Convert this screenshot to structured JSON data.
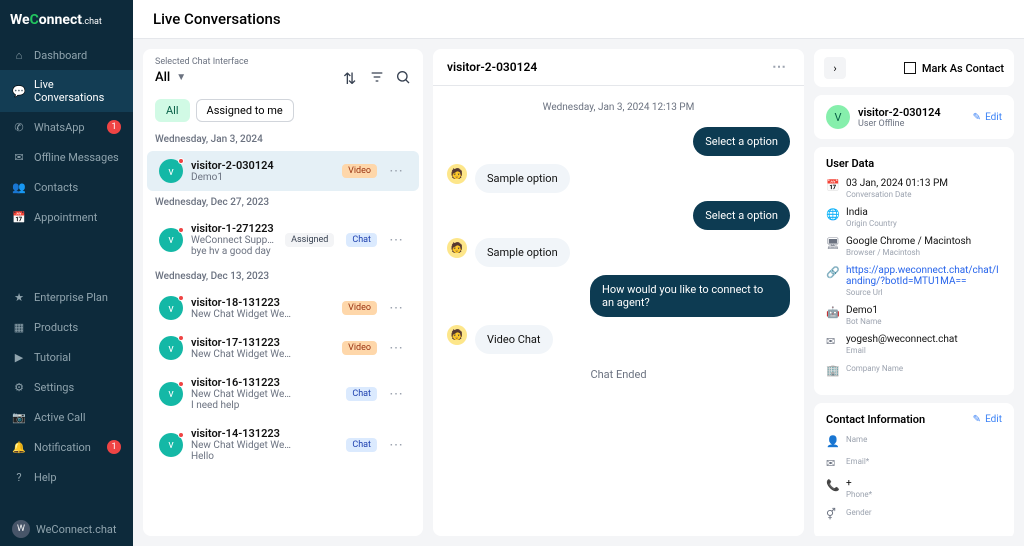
{
  "brand": {
    "pre": "We",
    "c": "C",
    "post": "onnect",
    "suffix": ".chat"
  },
  "page_title": "Live Conversations",
  "nav": [
    {
      "label": "Dashboard",
      "icon": "home"
    },
    {
      "label": "Live Conversations",
      "icon": "chat",
      "active": true
    },
    {
      "label": "WhatsApp",
      "icon": "whatsapp",
      "badge": "1"
    },
    {
      "label": "Offline Messages",
      "icon": "inbox"
    },
    {
      "label": "Contacts",
      "icon": "contacts"
    },
    {
      "label": "Appointment",
      "icon": "calendar"
    }
  ],
  "nav2": [
    {
      "label": "Enterprise Plan",
      "icon": "star"
    },
    {
      "label": "Products",
      "icon": "grid"
    },
    {
      "label": "Tutorial",
      "icon": "video"
    },
    {
      "label": "Settings",
      "icon": "gear"
    },
    {
      "label": "Active Call",
      "icon": "camera"
    },
    {
      "label": "Notification",
      "icon": "bell",
      "badge": "1"
    },
    {
      "label": "Help",
      "icon": "help"
    }
  ],
  "footer_user": "WeConnect.chat",
  "list": {
    "selected_label": "Selected Chat Interface",
    "selected_value": "All",
    "filter_all": "All",
    "filter_assigned": "Assigned to me",
    "groups": [
      {
        "date": "Wednesday, Jan 3, 2024",
        "items": [
          {
            "initial": "v",
            "name": "visitor-2-030124",
            "sub": "Demo1",
            "tag": "Video",
            "tagClass": "tag-video",
            "sel": true,
            "dot": true
          }
        ]
      },
      {
        "date": "Wednesday, Dec 27, 2023",
        "items": [
          {
            "initial": "v",
            "name": "visitor-1-271223",
            "sub": "WeConnect Support",
            "sub2": "bye hv a good day",
            "assigned": "Assigned",
            "tag": "Chat",
            "tagClass": "tag-chat",
            "dot": true
          }
        ]
      },
      {
        "date": "Wednesday, Dec 13, 2023",
        "items": [
          {
            "initial": "v",
            "name": "visitor-18-131223",
            "sub": "New Chat Widget We…",
            "tag": "Video",
            "tagClass": "tag-video",
            "dot": true
          },
          {
            "initial": "v",
            "name": "visitor-17-131223",
            "sub": "New Chat Widget We…",
            "tag": "Video",
            "tagClass": "tag-video",
            "dot": true
          },
          {
            "initial": "v",
            "name": "visitor-16-131223",
            "sub": "New Chat Widget We…",
            "sub2": "I need help",
            "tag": "Chat",
            "tagClass": "tag-chat",
            "dot": true
          },
          {
            "initial": "v",
            "name": "visitor-14-131223",
            "sub": "New Chat Widget We…",
            "sub2": "Hello",
            "tag": "Chat",
            "tagClass": "tag-chat",
            "dot": true
          }
        ]
      }
    ]
  },
  "chat": {
    "title": "visitor-2-030124",
    "date": "Wednesday, Jan 3, 2024 12:13 PM",
    "messages": [
      {
        "side": "right",
        "kind": "bot",
        "text": "Select a option"
      },
      {
        "side": "left",
        "kind": "user",
        "text": "Sample option"
      },
      {
        "side": "right",
        "kind": "bot",
        "text": "Select a option"
      },
      {
        "side": "left",
        "kind": "user",
        "text": "Sample option"
      },
      {
        "side": "right",
        "kind": "bot",
        "text": "How would you like to connect to an agent?"
      },
      {
        "side": "left",
        "kind": "user",
        "text": "Video Chat"
      }
    ],
    "ended": "Chat Ended"
  },
  "info": {
    "mark_contact": "Mark As Contact",
    "visitor_initial": "V",
    "visitor_name": "visitor-2-030124",
    "visitor_status": "User Offline",
    "edit": "Edit",
    "user_data_title": "User Data",
    "rows": [
      {
        "icon": "calendar",
        "val": "03 Jan, 2024 01:13 PM",
        "lbl": "Conversation Date"
      },
      {
        "icon": "globe",
        "val": "India",
        "lbl": "Origin Country"
      },
      {
        "icon": "monitor",
        "val": "Google Chrome / Macintosh",
        "lbl": "Browser / Macintosh"
      },
      {
        "icon": "link",
        "val": "https://app.weconnect.chat/chat/landing/?botId=MTU1MA==",
        "lbl": "Source Url",
        "link": true
      },
      {
        "icon": "bot",
        "val": "Demo1",
        "lbl": "Bot Name"
      },
      {
        "icon": "mail",
        "val": "yogesh@weconnect.chat",
        "lbl": "Email"
      },
      {
        "icon": "building",
        "val": "",
        "lbl": "Company Name"
      }
    ],
    "contact_title": "Contact Information",
    "contact_rows": [
      {
        "icon": "user",
        "lbl": "Name"
      },
      {
        "icon": "mail",
        "lbl": "Email*"
      },
      {
        "icon": "phone",
        "val": "+",
        "lbl": "Phone*"
      },
      {
        "icon": "gender",
        "lbl": "Gender"
      }
    ]
  }
}
